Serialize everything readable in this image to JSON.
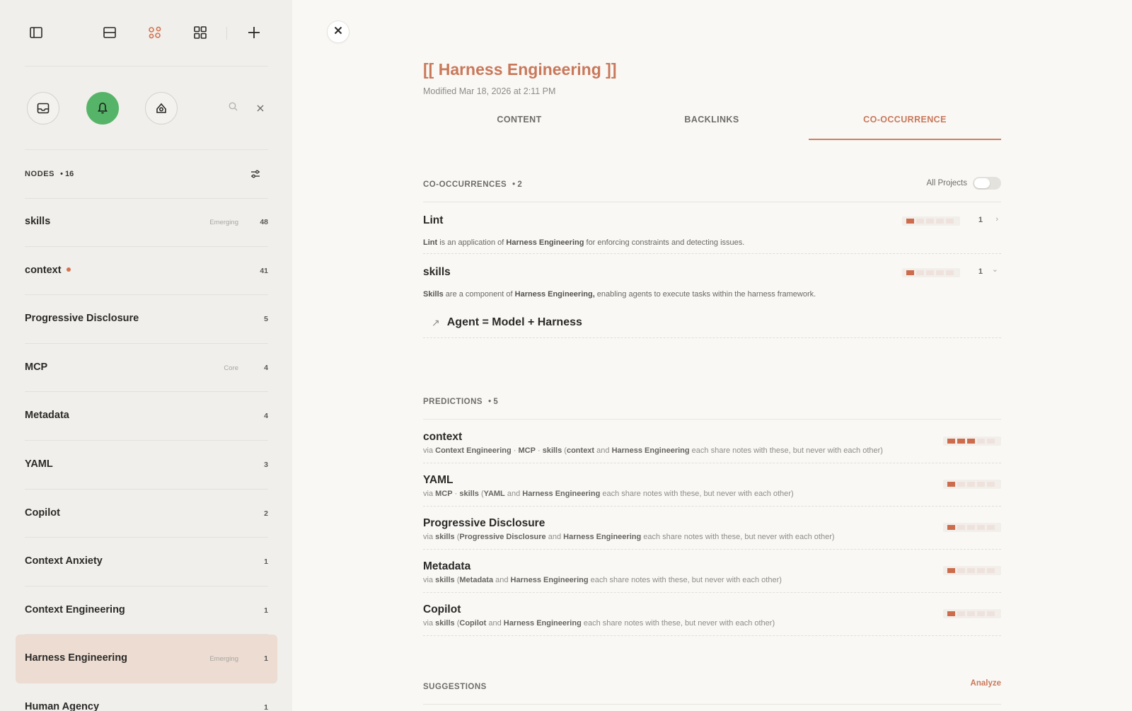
{
  "sidebar": {
    "toolbar": {
      "icons": [
        "sidebar-toggle-icon",
        "split-view-icon",
        "graph-view-icon",
        "grid-view-icon",
        "plus-icon"
      ],
      "accent": "#d4724f"
    },
    "quick_actions": {
      "icons": [
        "inbox-icon",
        "bell-icon",
        "robot-icon",
        "search-icon",
        "collapse-icon"
      ],
      "active_color": "#56b468"
    },
    "nodes_header": {
      "label": "NODES",
      "count": "• 16"
    },
    "nodes": [
      {
        "name": "skills",
        "tag": "Emerging",
        "count": "48"
      },
      {
        "name": "context",
        "tag": "",
        "count": "41",
        "dot": true
      },
      {
        "name": "Progressive Disclosure",
        "tag": "",
        "count": "5"
      },
      {
        "name": "MCP",
        "tag": "Core",
        "count": "4"
      },
      {
        "name": "Metadata",
        "tag": "",
        "count": "4"
      },
      {
        "name": "YAML",
        "tag": "",
        "count": "3"
      },
      {
        "name": "Copilot",
        "tag": "",
        "count": "2"
      },
      {
        "name": "Context Anxiety",
        "tag": "",
        "count": "1"
      },
      {
        "name": "Context Engineering",
        "tag": "",
        "count": "1"
      },
      {
        "name": "Harness Engineering",
        "tag": "Emerging",
        "count": "1",
        "selected": true
      },
      {
        "name": "Human Agency",
        "tag": "",
        "count": "1"
      }
    ]
  },
  "main": {
    "title": "[[ Harness Engineering ]]",
    "modified": "Modified Mar 18, 2026 at 2:11 PM",
    "tabs": [
      {
        "label": "CONTENT",
        "active": false
      },
      {
        "label": "BACKLINKS",
        "active": false
      },
      {
        "label": "CO-OCCURRENCE",
        "active": true
      }
    ],
    "cooccurrences": {
      "label": "CO-OCCURRENCES",
      "count": "• 2",
      "toggle_label": "All Projects",
      "toggle_on": false,
      "items": [
        {
          "name": "Lint",
          "strength": 1,
          "count": "1",
          "chevron": "›",
          "desc_parts": [
            {
              "b": "Lint"
            },
            {
              "t": " is an application of "
            },
            {
              "b": "Harness Engineering"
            },
            {
              "t": " for enforcing constraints and detecting issues."
            }
          ]
        },
        {
          "name": "skills",
          "strength": 1,
          "count": "1",
          "chevron": "⌄",
          "desc_parts": [
            {
              "b": "Skills"
            },
            {
              "t": " are a component of "
            },
            {
              "b": "Harness Engineering,"
            },
            {
              "t": " enabling agents to execute tasks within the harness framework."
            }
          ]
        }
      ],
      "link": {
        "arrow": "↗",
        "label": "Agent = Model + Harness"
      }
    },
    "predictions": {
      "label": "PREDICTIONS",
      "count": "• 5",
      "items": [
        {
          "name": "context",
          "strength": 3,
          "via_parts": [
            {
              "t": "via "
            },
            {
              "b": "Context Engineering"
            },
            {
              "t": " · "
            },
            {
              "b": "MCP"
            },
            {
              "t": " · "
            },
            {
              "b": "skills"
            },
            {
              "t": " ("
            },
            {
              "b": "context"
            },
            {
              "t": " and "
            },
            {
              "b": "Harness Engineering"
            },
            {
              "t": " each share notes with these, but never with each other)"
            }
          ]
        },
        {
          "name": "YAML",
          "strength": 1,
          "via_parts": [
            {
              "t": "via "
            },
            {
              "b": "MCP"
            },
            {
              "t": " · "
            },
            {
              "b": "skills"
            },
            {
              "t": " ("
            },
            {
              "b": "YAML"
            },
            {
              "t": " and "
            },
            {
              "b": "Harness Engineering"
            },
            {
              "t": " each share notes with these, but never with each other)"
            }
          ]
        },
        {
          "name": "Progressive Disclosure",
          "strength": 1,
          "via_parts": [
            {
              "t": "via "
            },
            {
              "b": "skills"
            },
            {
              "t": " ("
            },
            {
              "b": "Progressive Disclosure"
            },
            {
              "t": " and "
            },
            {
              "b": "Harness Engineering"
            },
            {
              "t": " each share notes with these, but never with each other)"
            }
          ]
        },
        {
          "name": "Metadata",
          "strength": 1,
          "via_parts": [
            {
              "t": "via "
            },
            {
              "b": "skills"
            },
            {
              "t": " ("
            },
            {
              "b": "Metadata"
            },
            {
              "t": " and "
            },
            {
              "b": "Harness Engineering"
            },
            {
              "t": " each share notes with these, but never with each other)"
            }
          ]
        },
        {
          "name": "Copilot",
          "strength": 1,
          "via_parts": [
            {
              "t": "via "
            },
            {
              "b": "skills"
            },
            {
              "t": " ("
            },
            {
              "b": "Copilot"
            },
            {
              "t": " and "
            },
            {
              "b": "Harness Engineering"
            },
            {
              "t": " each share notes with these, but never with each other)"
            }
          ]
        }
      ]
    },
    "suggestions": {
      "label": "SUGGESTIONS",
      "action": "Analyze"
    },
    "colors": {
      "accent": "#c9785a",
      "strength_on": "#cd6c4d",
      "strength_off": "#efe2dc",
      "selected_row": "#ecdcd1"
    }
  }
}
